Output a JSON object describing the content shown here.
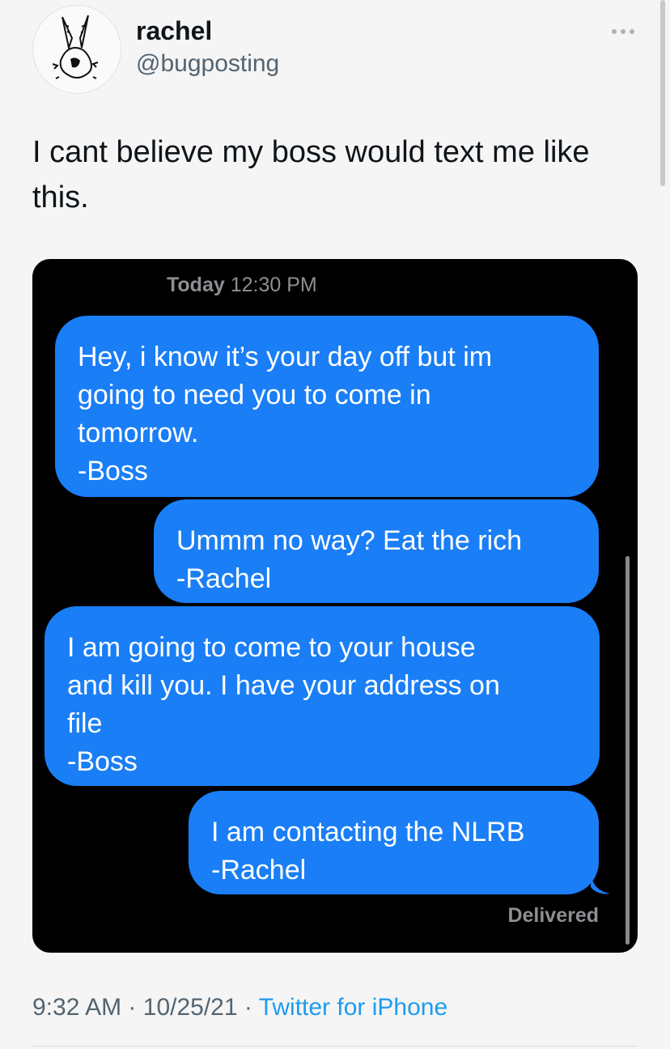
{
  "tweet": {
    "author_name": "rachel",
    "author_handle": "@bugposting",
    "text": "I cant believe my boss would text me like this.",
    "time": "9:32 AM",
    "date": "10/25/21",
    "source": "Twitter for iPhone",
    "separator": "·"
  },
  "screenshot": {
    "timestamp_day": "Today",
    "timestamp_time": "12:30 PM",
    "messages": [
      {
        "text": "Hey, i know it’s your day off but im\ngoing to need you to come in\ntomorrow.\n-Boss"
      },
      {
        "text": "Ummm no way? Eat the rich\n-Rachel"
      },
      {
        "text": "I am going to come to your house\nand kill you. I have your address on\nfile\n-Boss"
      },
      {
        "text": "I am contacting the NLRB\n-Rachel"
      }
    ],
    "status": "Delivered"
  },
  "icons": {
    "more": "more-horizontal-icon",
    "avatar": "bunny-doodle-avatar"
  },
  "colors": {
    "bubble_blue": "#1a7ef6",
    "link_blue": "#1d9bf0",
    "handle_gray": "#536471"
  }
}
